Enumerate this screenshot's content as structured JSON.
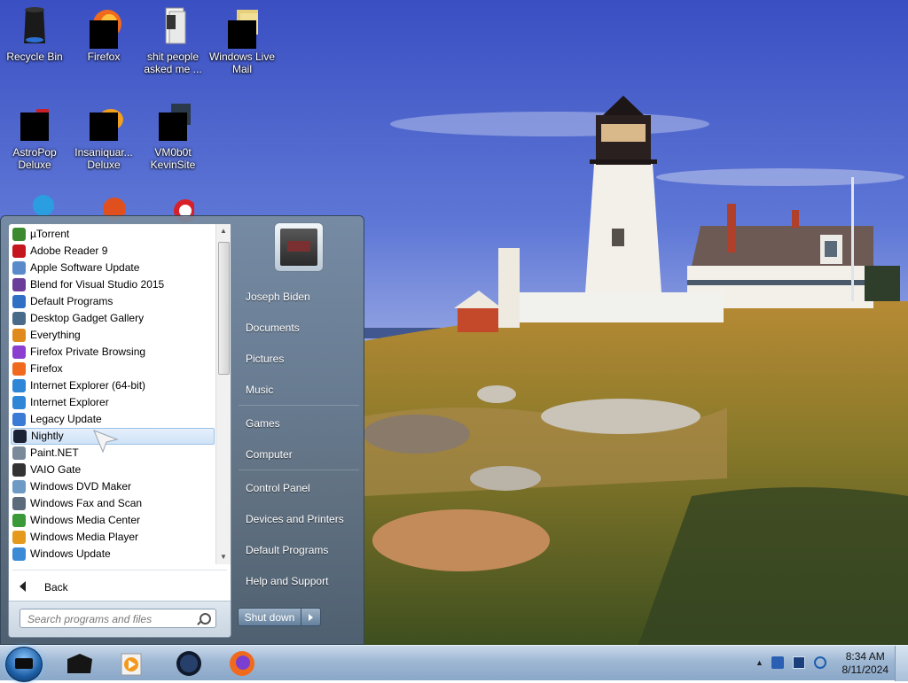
{
  "desktop": {
    "icons": [
      {
        "label": "Recycle Bin"
      },
      {
        "label": "Firefox"
      },
      {
        "label": "shit people asked me ..."
      },
      {
        "label": "Windows Live Mail"
      },
      {
        "label": "AstroPop Deluxe"
      },
      {
        "label": "Insaniquar... Deluxe"
      },
      {
        "label": "VM0b0t KevinSite"
      }
    ]
  },
  "start_menu": {
    "programs": [
      {
        "label": "µTorrent",
        "icon": "utorrent-icon",
        "color": "#3c8a2e"
      },
      {
        "label": "Adobe Reader 9",
        "icon": "adobe-reader-icon",
        "color": "#c4161c"
      },
      {
        "label": "Apple Software Update",
        "icon": "apple-update-icon",
        "color": "#5a8ac9"
      },
      {
        "label": "Blend for Visual Studio 2015",
        "icon": "blend-icon",
        "color": "#6a3d9a"
      },
      {
        "label": "Default Programs",
        "icon": "default-programs-icon",
        "color": "#2f6fc4"
      },
      {
        "label": "Desktop Gadget Gallery",
        "icon": "gadget-gallery-icon",
        "color": "#4a6a8a"
      },
      {
        "label": "Everything",
        "icon": "everything-icon",
        "color": "#e08a1e"
      },
      {
        "label": "Firefox Private Browsing",
        "icon": "firefox-private-icon",
        "color": "#8b3fd1"
      },
      {
        "label": "Firefox",
        "icon": "firefox-icon",
        "color": "#f06a1d"
      },
      {
        "label": "Internet Explorer (64-bit)",
        "icon": "ie-icon",
        "color": "#2f86d6"
      },
      {
        "label": "Internet Explorer",
        "icon": "ie-icon",
        "color": "#2f86d6"
      },
      {
        "label": "Legacy Update",
        "icon": "legacy-update-icon",
        "color": "#3a7bd5"
      },
      {
        "label": "Nightly",
        "icon": "nightly-icon",
        "color": "#1b2233"
      },
      {
        "label": "Paint.NET",
        "icon": "paintnet-icon",
        "color": "#7a8a9a"
      },
      {
        "label": "VAIO Gate",
        "icon": "vaio-gate-icon",
        "color": "#333333"
      },
      {
        "label": "Windows DVD Maker",
        "icon": "dvd-maker-icon",
        "color": "#6d9bc5"
      },
      {
        "label": "Windows Fax and Scan",
        "icon": "fax-scan-icon",
        "color": "#5b6b7b"
      },
      {
        "label": "Windows Media Center",
        "icon": "media-center-icon",
        "color": "#3a9a3a"
      },
      {
        "label": "Windows Media Player",
        "icon": "media-player-icon",
        "color": "#e59a1e"
      },
      {
        "label": "Windows Update",
        "icon": "windows-update-icon",
        "color": "#3a8ad6"
      }
    ],
    "selected_index": 12,
    "back_label": "Back",
    "search_placeholder": "Search programs and files",
    "right_links": {
      "user": "Joseph Biden",
      "documents": "Documents",
      "pictures": "Pictures",
      "music": "Music",
      "games": "Games",
      "computer": "Computer",
      "control_panel": "Control Panel",
      "devices_printers": "Devices and Printers",
      "default_programs": "Default Programs",
      "help_support": "Help and Support"
    },
    "shutdown_label": "Shut down"
  },
  "taskbar": {
    "clock_time": "8:34 AM",
    "clock_date": "8/11/2024"
  }
}
